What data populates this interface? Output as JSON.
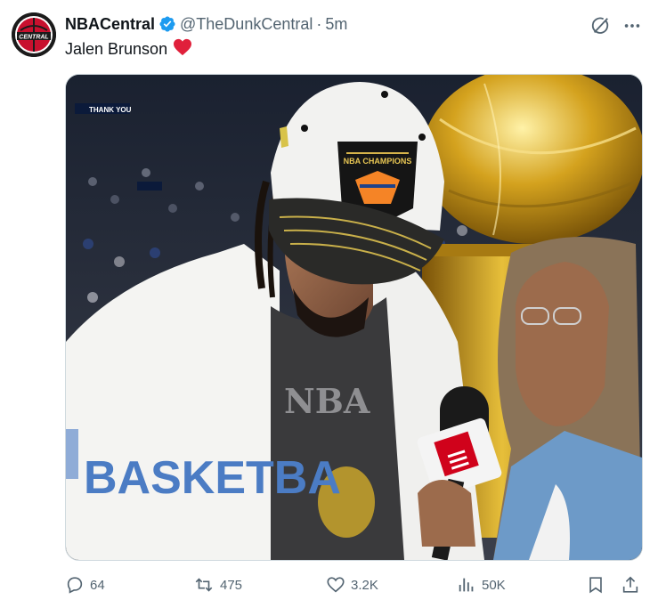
{
  "tweet": {
    "display_name": "NBACentral",
    "handle": "@TheDunkCentral",
    "separator": "·",
    "time": "5m",
    "text": "Jalen Brunson",
    "emoji": "heart-emoji",
    "avatar_text": "CENTRAL",
    "verified_color": "#1d9bf0"
  },
  "media": {
    "scoreboard_text": "THANK YOU",
    "hat_badge_text": "NBA CHAMPIONS",
    "towel_text": "BASKETBA",
    "shirt_text": "NBA"
  },
  "actions": {
    "reply_count": "64",
    "retweet_count": "475",
    "like_count": "3.2K",
    "views_count": "50K"
  },
  "colors": {
    "text_primary": "#0f1419",
    "text_secondary": "#536471",
    "heart": "#f91880"
  },
  "icons": [
    "grok-icon",
    "more-icon",
    "reply-icon",
    "retweet-icon",
    "like-icon",
    "views-icon",
    "bookmark-icon",
    "share-icon"
  ]
}
